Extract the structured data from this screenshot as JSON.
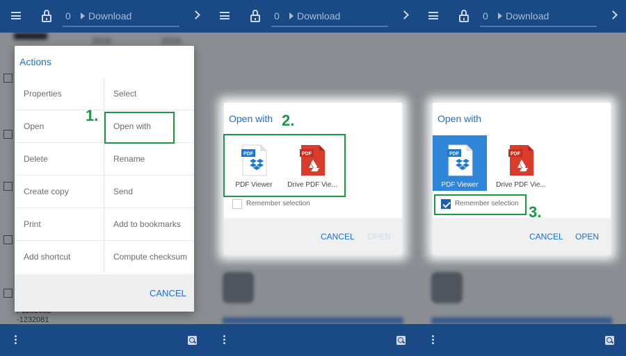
{
  "topbar": {
    "crumb_zero": "0",
    "crumb_text": "Download"
  },
  "background": {
    "dates": [
      "2018-",
      "2018-"
    ],
    "small_text_1": "1232081",
    "small_text_2": "F1232082",
    "small_text_3": "-1232081"
  },
  "actions_dialog": {
    "title": "Actions",
    "items_left": [
      "Properties",
      "Open",
      "Delete",
      "Create copy",
      "Print",
      "Add shortcut"
    ],
    "items_right": [
      "Select",
      "Open with",
      "Rename",
      "Send",
      "Add to bookmarks",
      "Compute checksum"
    ],
    "cancel_label": "CANCEL"
  },
  "open_with_dialog": {
    "title": "Open with",
    "apps": [
      {
        "name": "PDF Viewer",
        "icon": "pdf-viewer-icon"
      },
      {
        "name": "Drive PDF Vie...",
        "icon": "drive-pdf-viewer-icon"
      }
    ],
    "pdf_badge": "PDF",
    "remember_label": "Remember selection",
    "cancel_label": "CANCEL",
    "open_label": "OPEN"
  },
  "annotations": {
    "step1": "1.",
    "step2": "2.",
    "step3": "3."
  },
  "colors": {
    "accent": "#1f6fd1",
    "bar": "#1a4a86",
    "annotation": "#1a9944",
    "selected": "#2f86d8",
    "pdf_viewer_badge": "#1976d2",
    "drive_pdf": "#d93c2b"
  }
}
